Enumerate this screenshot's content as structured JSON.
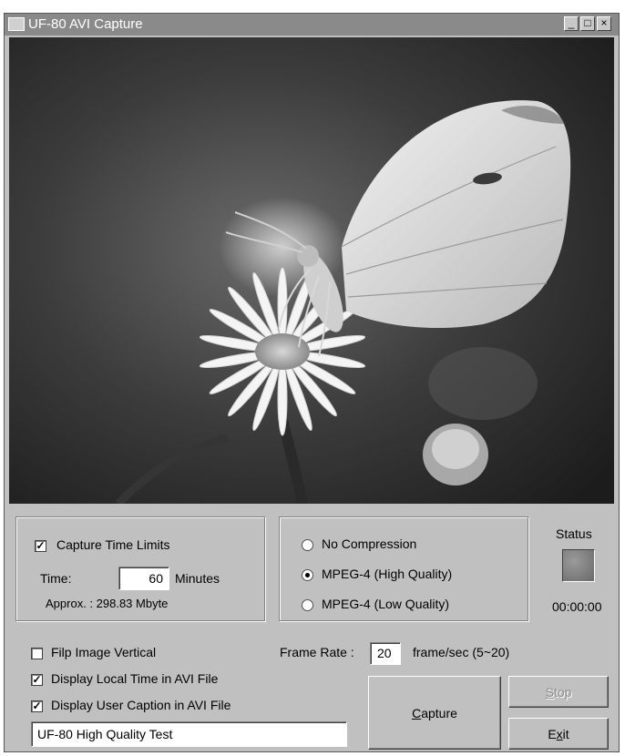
{
  "window": {
    "title": "UF-80 AVI Capture"
  },
  "titlebar_buttons": {
    "minimize": "_",
    "maximize": "□",
    "close": "×"
  },
  "time_group": {
    "capture_limits_label": "Capture Time Limits",
    "capture_limits_checked": true,
    "time_label": "Time:",
    "time_value": "60",
    "time_unit": "Minutes",
    "approx_text": "Approx. : 298.83 Mbyte"
  },
  "compression": {
    "options": [
      {
        "label": "No Compression",
        "selected": false
      },
      {
        "label": "MPEG-4 (High Quality)",
        "selected": true
      },
      {
        "label": "MPEG-4 (Low Quality)",
        "selected": false
      }
    ]
  },
  "status": {
    "label": "Status",
    "time": "00:00:00"
  },
  "options": {
    "flip_label": "Filp Image Vertical",
    "flip_checked": false,
    "local_time_label": "Display Local Time in AVI File",
    "local_time_checked": true,
    "caption_label": "Display User Caption in AVI File",
    "caption_checked": true,
    "caption_value": "UF-80 High Quality Test"
  },
  "frame_rate": {
    "label": "Frame Rate :",
    "value": "20",
    "unit": "frame/sec (5~20)"
  },
  "buttons": {
    "capture": {
      "mnemonic": "C",
      "rest": "apture"
    },
    "stop": {
      "mnemonic": "S",
      "rest": "top"
    },
    "exit_pre": "E",
    "exit_mnemonic": "x",
    "exit_rest": "it"
  },
  "colors": {
    "titlebar": "#8a8a8a",
    "window": "#c0c0c0",
    "disabled_text": "#8c8c8c"
  }
}
